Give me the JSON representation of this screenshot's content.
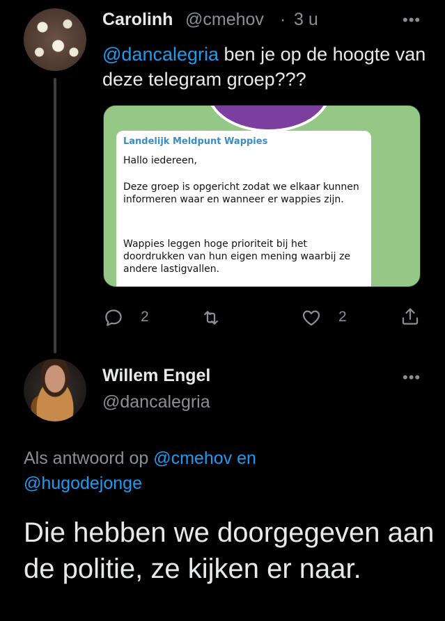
{
  "tweet1": {
    "name": "Carolinh",
    "handle": "@cmehov",
    "separator": "·",
    "time": "3 u",
    "more": "•••",
    "mention": "@dancalegria",
    "text": " ben je op de hoogte van deze telegram groep???",
    "image": {
      "title": "Landelijk Meldpunt Wappies",
      "p1": "Hallo iedereen,",
      "p2": "Deze groep is opgericht zodat we  elkaar kunnen informeren waar en wanneer er wappies zijn.",
      "p3": "Wappies leggen hoge prioriteit bij het doordrukken van hun eigen mening waarbij ze andere lastigvallen."
    },
    "actions": {
      "reply_count": "2",
      "retweet_count": "",
      "like_count": "2"
    }
  },
  "tweet2": {
    "name": "Willem Engel",
    "handle": "@dancalegria",
    "more": "•••",
    "reply_prefix": "Als antwoord op ",
    "reply_mention1": "@cmehov en",
    "reply_mention2": "@hugodejonge",
    "text": "Die hebben we doorgegeven aan de politie, ze kijken er naar."
  },
  "colors": {
    "background": "#000000",
    "accent": "#1d9bf0",
    "muted": "#8b8f94",
    "image_bg": "#95c887"
  }
}
